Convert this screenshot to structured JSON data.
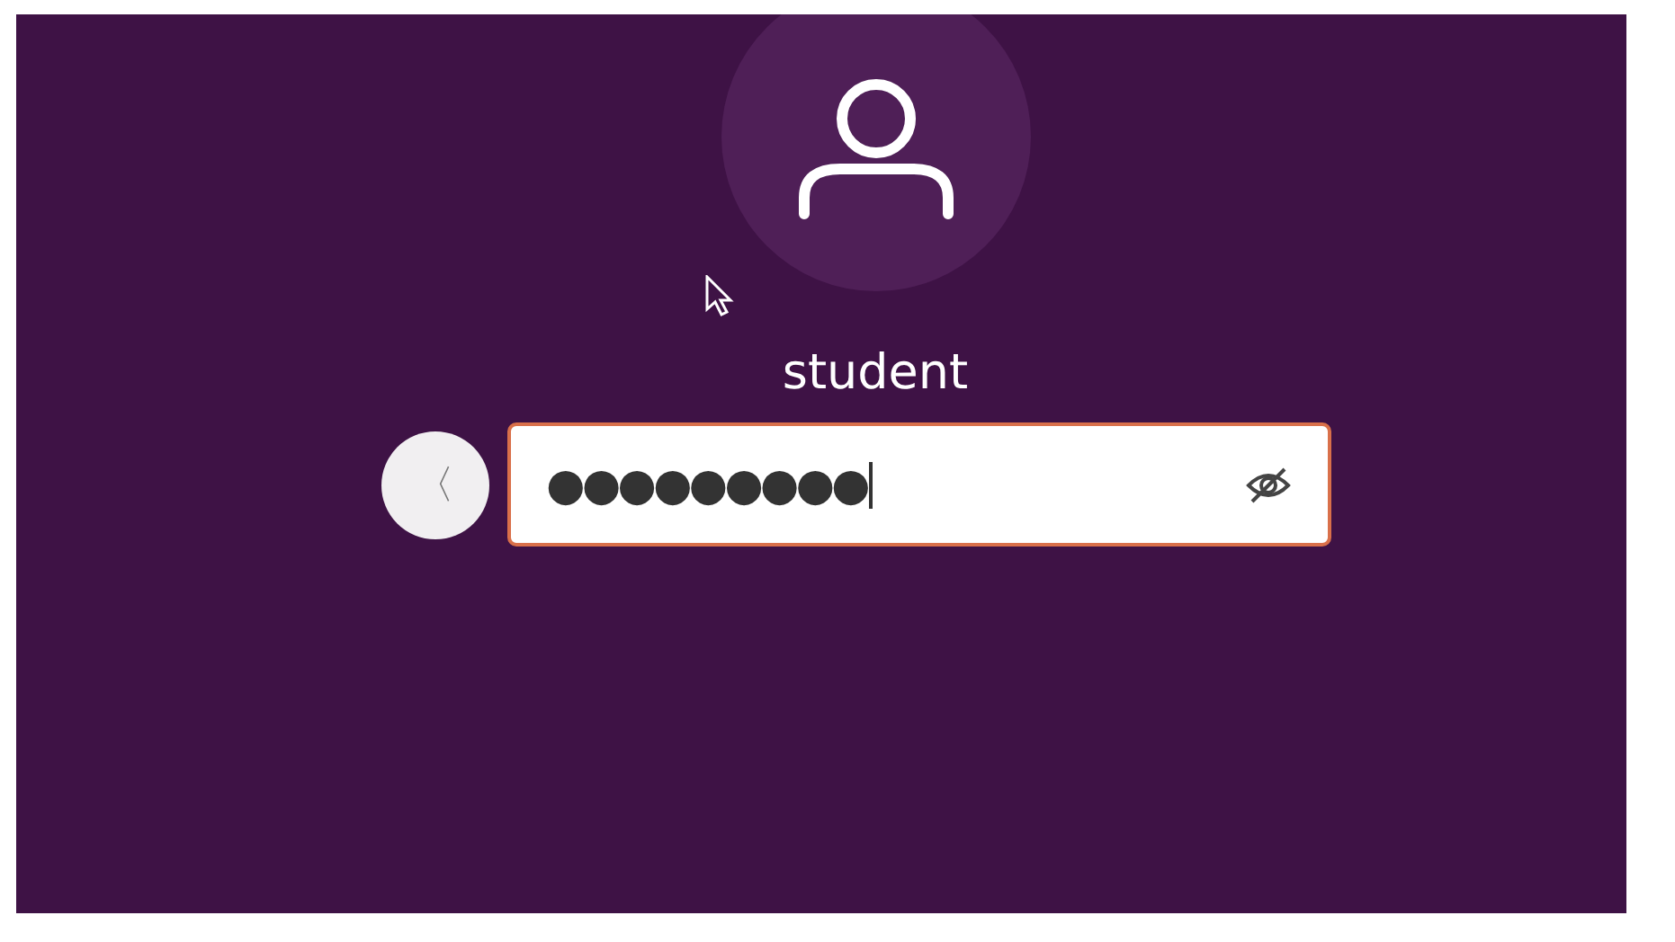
{
  "user": {
    "name": "student"
  },
  "password_field": {
    "value": "●●●●●●●●●",
    "focused": true,
    "reveal_hidden": true
  },
  "back_button": {
    "label": "〈"
  }
}
